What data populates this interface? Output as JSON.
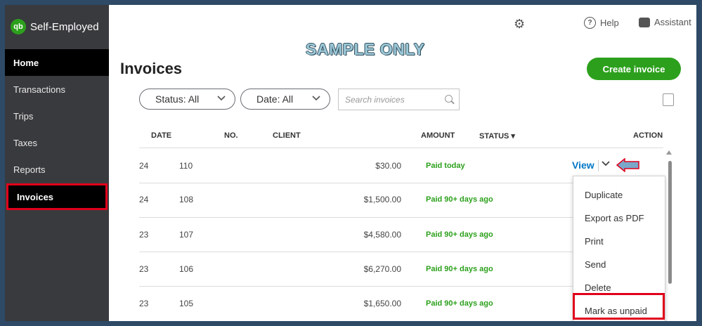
{
  "app": {
    "logo_text": "qb",
    "name": "Self-Employed"
  },
  "sidebar": {
    "items": [
      {
        "label": "Home"
      },
      {
        "label": "Transactions"
      },
      {
        "label": "Trips"
      },
      {
        "label": "Taxes"
      },
      {
        "label": "Reports"
      },
      {
        "label": "Invoices"
      }
    ]
  },
  "header": {
    "help_label": "Help",
    "assistant_label": "Assistant",
    "watermark": "SAMPLE ONLY"
  },
  "page": {
    "title": "Invoices",
    "create_button": "Create invoice"
  },
  "filters": {
    "status_label": "Status: All",
    "date_label": "Date: All",
    "search_placeholder": "Search invoices"
  },
  "table": {
    "headers": {
      "date": "DATE",
      "no": "NO.",
      "client": "CLIENT",
      "amount": "AMOUNT",
      "status": "STATUS ▾",
      "action": "ACTION"
    },
    "rows": [
      {
        "date": "24",
        "no": "110",
        "client": "",
        "amount": "$30.00",
        "status": "Paid today"
      },
      {
        "date": "24",
        "no": "108",
        "client": "",
        "amount": "$1,500.00",
        "status": "Paid 90+ days ago"
      },
      {
        "date": "23",
        "no": "107",
        "client": "",
        "amount": "$4,580.00",
        "status": "Paid 90+ days ago"
      },
      {
        "date": "23",
        "no": "106",
        "client": "",
        "amount": "$6,270.00",
        "status": "Paid 90+ days ago"
      },
      {
        "date": "23",
        "no": "105",
        "client": "",
        "amount": "$1,650.00",
        "status": "Paid 90+ days ago"
      }
    ],
    "view_label": "View"
  },
  "action_menu": {
    "items": [
      {
        "label": "Duplicate"
      },
      {
        "label": "Export as PDF"
      },
      {
        "label": "Print"
      },
      {
        "label": "Send"
      },
      {
        "label": "Delete"
      },
      {
        "label": "Mark as unpaid"
      }
    ]
  },
  "colors": {
    "brand_green": "#2ca01c",
    "sidebar_bg": "#393a3d",
    "link_blue": "#0077c5",
    "highlight_red": "#e0001b"
  }
}
